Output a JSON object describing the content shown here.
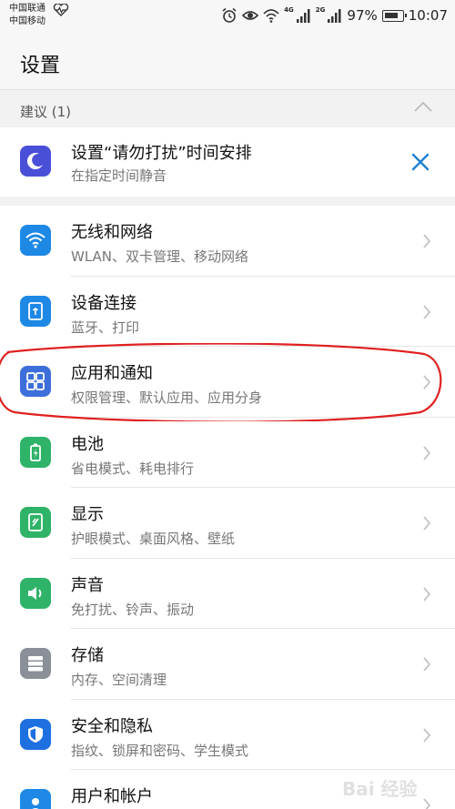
{
  "status_bar": {
    "carrier_1": "中国联通",
    "carrier_2": "中国移动",
    "net_tag_1": "4G",
    "net_tag_2": "2G",
    "battery_percent": "97%",
    "time": "10:07"
  },
  "header": {
    "title": "设置"
  },
  "suggestions": {
    "header_label": "建议 (1)",
    "card": {
      "title": "设置“请勿打扰”时间安排",
      "subtitle": "在指定时间静音",
      "icon_color": "#4a4fd8"
    }
  },
  "settings": [
    {
      "label": "无线和网络",
      "subtitle": "WLAN、双卡管理、移动网络",
      "icon": "wifi-icon",
      "color": "#1e88e5"
    },
    {
      "label": "设备连接",
      "subtitle": "蓝牙、打印",
      "icon": "device-connection-icon",
      "color": "#1e88e5"
    },
    {
      "label": "应用和通知",
      "subtitle": "权限管理、默认应用、应用分身",
      "icon": "apps-grid-icon",
      "color": "#3d6fdb"
    },
    {
      "label": "电池",
      "subtitle": "省电模式、耗电排行",
      "icon": "battery-icon",
      "color": "#2fb368"
    },
    {
      "label": "显示",
      "subtitle": "护眼模式、桌面风格、壁纸",
      "icon": "display-icon",
      "color": "#2fb368"
    },
    {
      "label": "声音",
      "subtitle": "免打扰、铃声、振动",
      "icon": "sound-icon",
      "color": "#2fb368"
    },
    {
      "label": "存储",
      "subtitle": "内存、空间清理",
      "icon": "storage-icon",
      "color": "#8a8f98"
    },
    {
      "label": "安全和隐私",
      "subtitle": "指纹、锁屏和密码、学生模式",
      "icon": "shield-icon",
      "color": "#1e6fe0"
    },
    {
      "label": "用户和帐户",
      "subtitle": "",
      "icon": "user-icon",
      "color": "#1e88e5"
    }
  ],
  "annotation_color": "#e02020",
  "watermark": {
    "text": "Bai 经验"
  }
}
